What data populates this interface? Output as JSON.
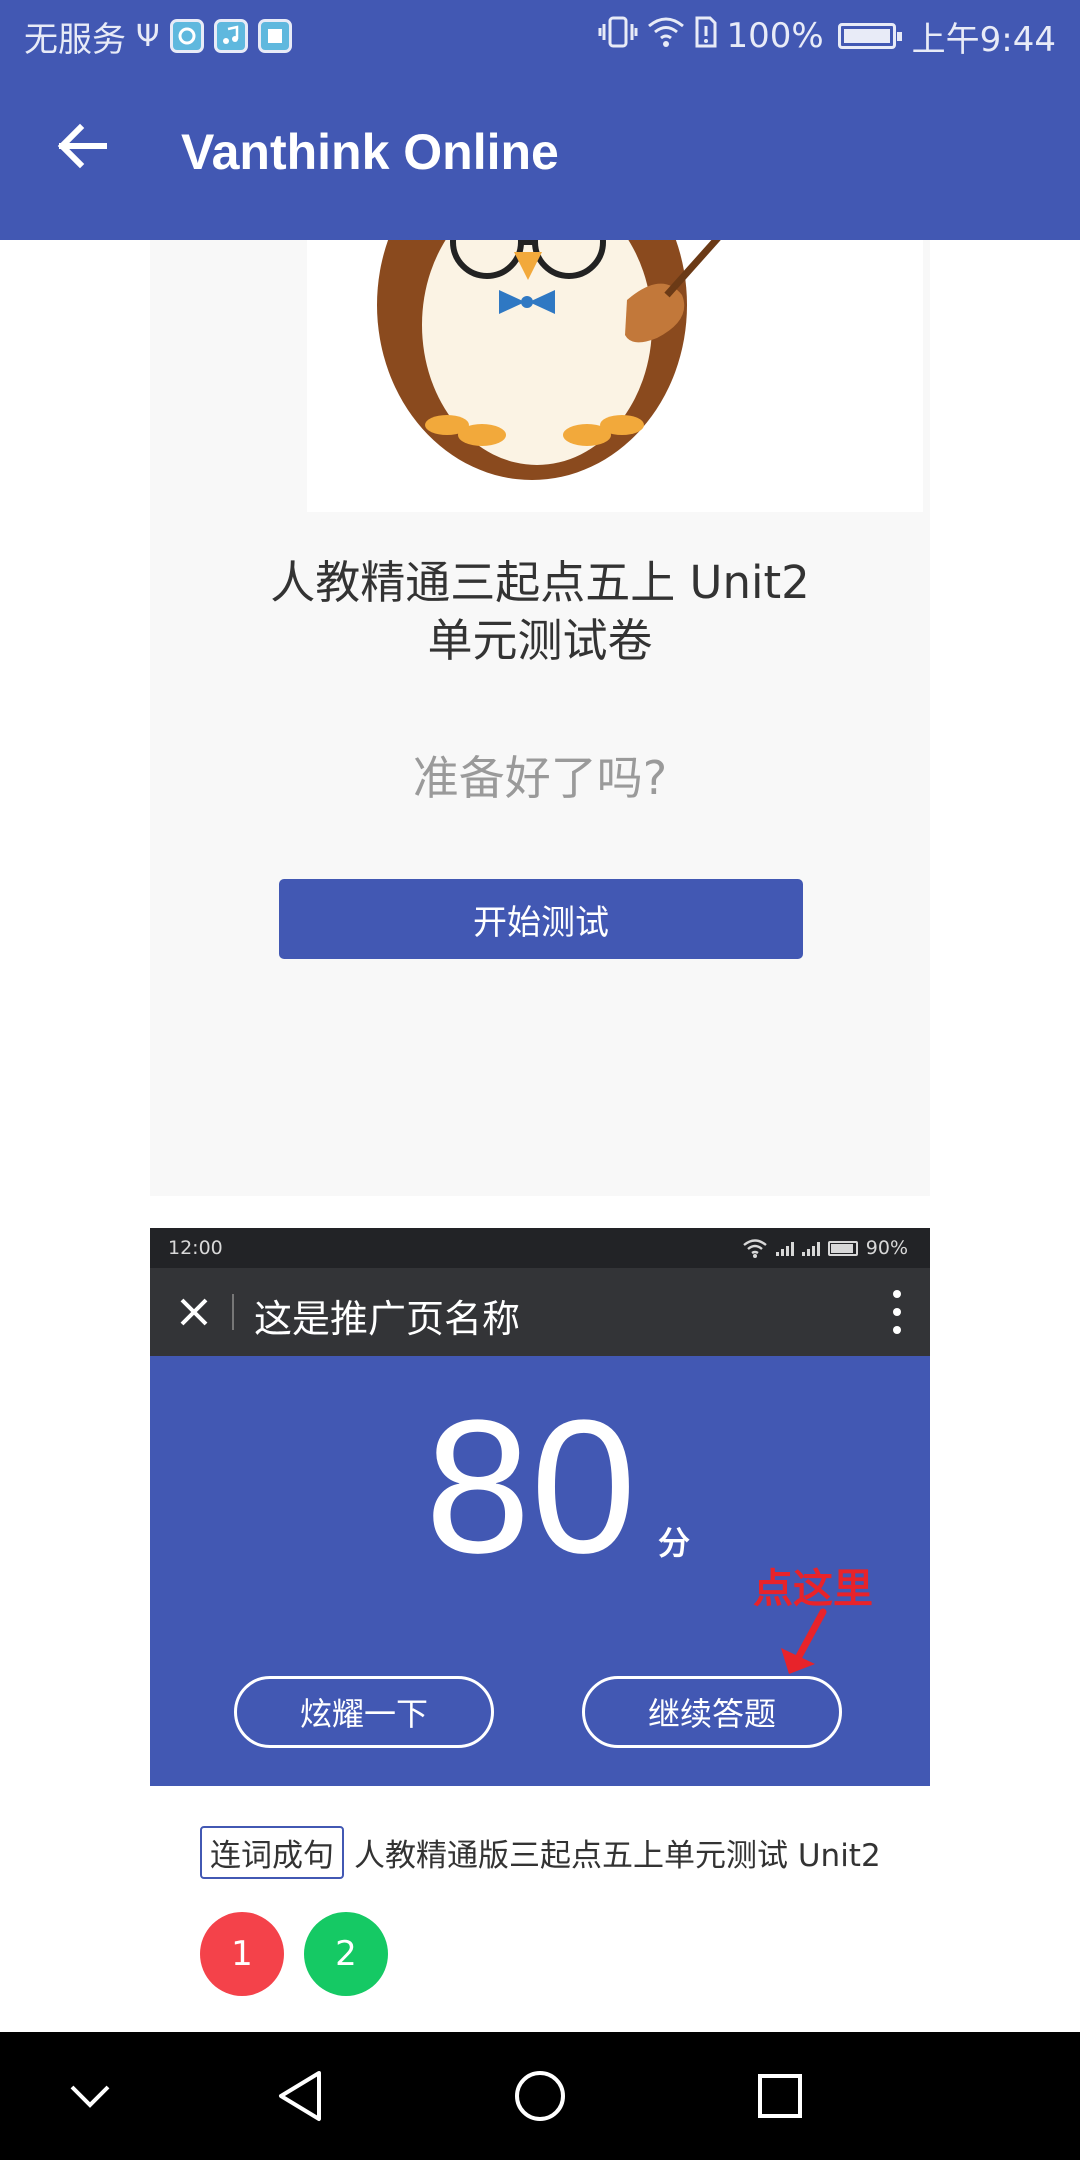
{
  "status_bar": {
    "carrier": "无服务",
    "battery_percent": "100%",
    "time": "上午9:44",
    "battery_level": 1.0
  },
  "app_bar": {
    "title": "Vanthink Online",
    "back_icon": "arrow-left-icon"
  },
  "test_card": {
    "title_line1": "人教精通三起点五上 Unit2",
    "title_line2": "单元测试卷",
    "ready_text": "准备好了吗?",
    "start_button": "开始测试"
  },
  "embedded_screenshot": {
    "status_time": "12:00",
    "status_battery": "90%",
    "toolbar_title": "这是推广页名称",
    "score": "80",
    "score_unit": "分",
    "annotation": "点这里",
    "share_button": "炫耀一下",
    "continue_button": "继续答题",
    "tag": "连词成句",
    "sentence": "人教精通版三起点五上单元测试 Unit2",
    "question_numbers": [
      "1",
      "2"
    ],
    "annotation_color": "#e8232a"
  },
  "colors": {
    "primary": "#4258b3",
    "red_circle": "#f4424a",
    "green_circle": "#15c964"
  }
}
